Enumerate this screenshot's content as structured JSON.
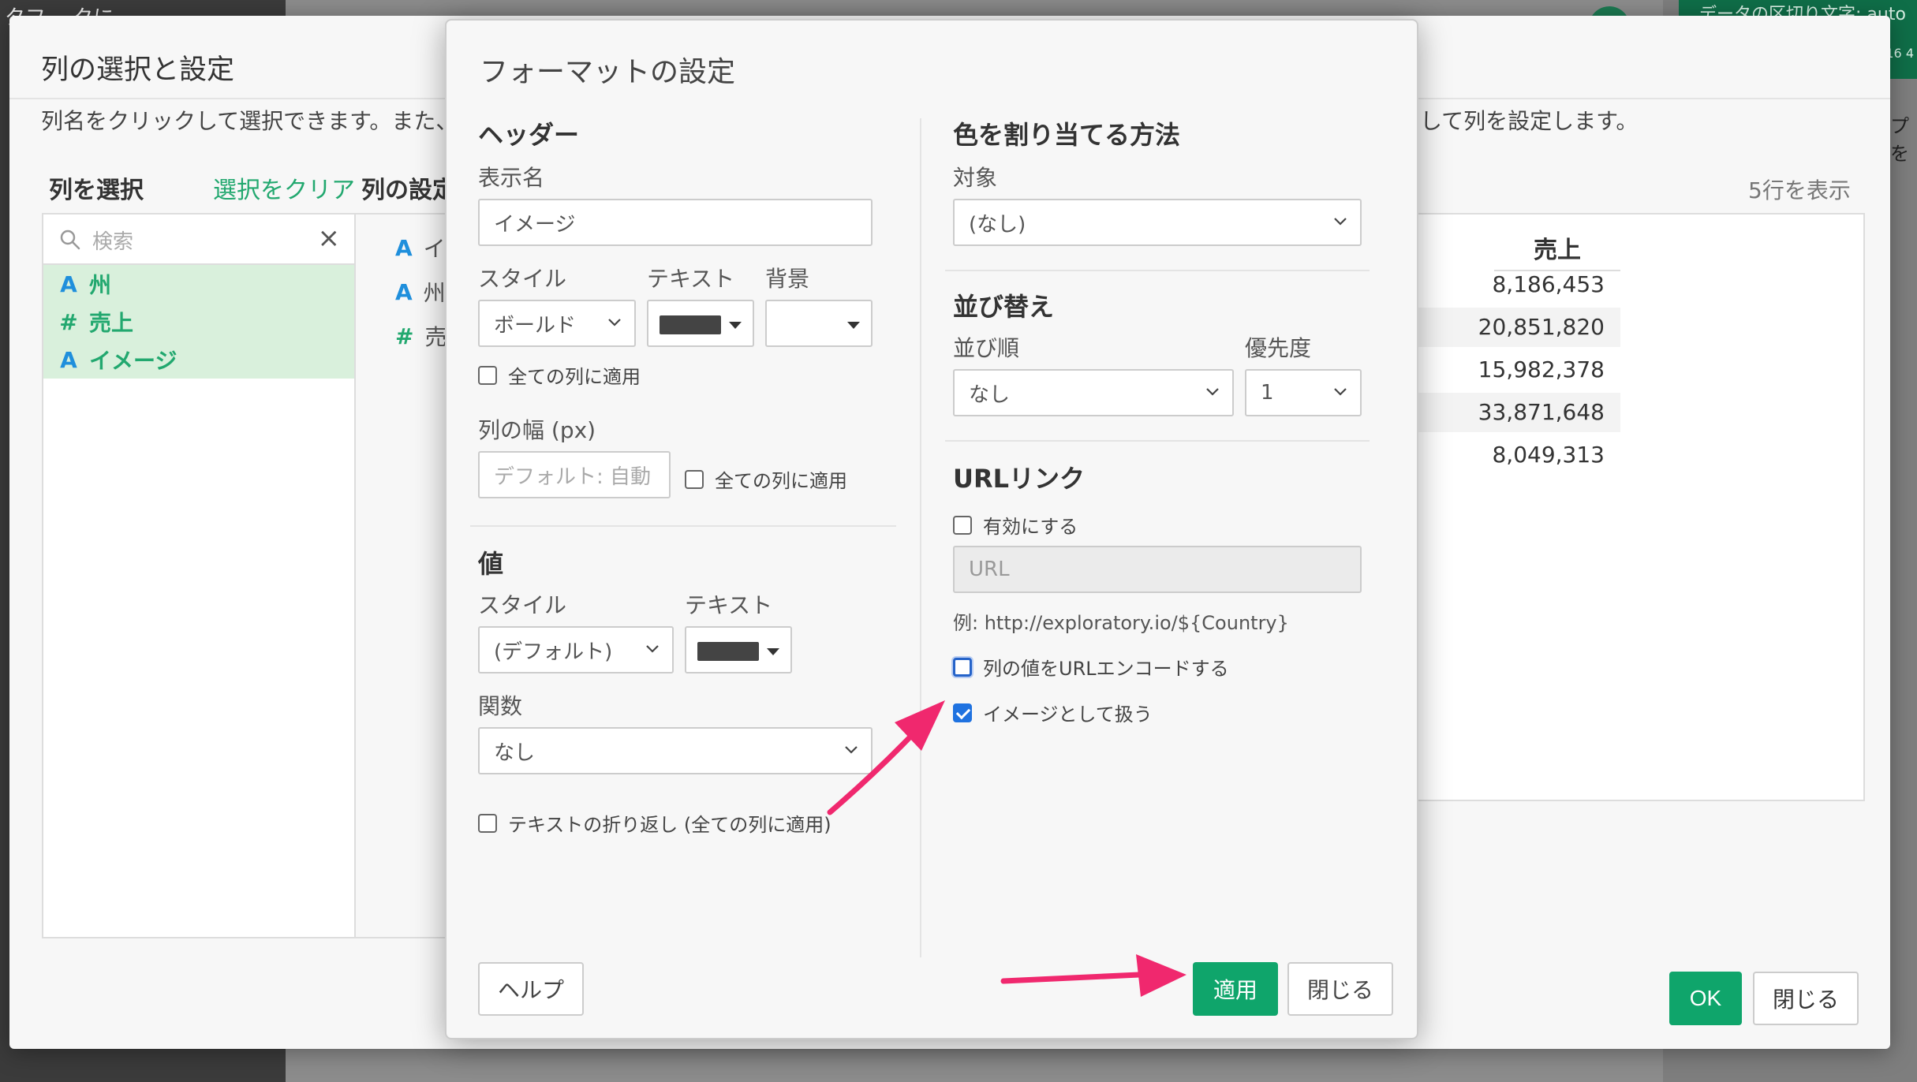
{
  "background": {
    "left_strip_text": "タフ… クに …",
    "green_bar_text": "データの区切り文字: auto",
    "green_bar_sub": "16 4",
    "right_fragment": "プを"
  },
  "outer_dialog": {
    "title": "列の選択と設定",
    "description_left": "列名をクリックして選択できます。また、",
    "description_right": "ーして列を設定します。",
    "select_heading": "列を選択",
    "clear_selection": "選択をクリア",
    "config_heading": "列の設定",
    "search_placeholder": "検索",
    "columns": [
      {
        "type_icon": "A",
        "name": "州"
      },
      {
        "type_icon": "#",
        "name": "売上"
      },
      {
        "type_icon": "A",
        "name": "イメージ"
      }
    ],
    "config_columns": [
      {
        "type_icon": "A",
        "name": "イ"
      },
      {
        "type_icon": "A",
        "name": "州"
      },
      {
        "type_icon": "#",
        "name": "売"
      }
    ],
    "rows_label": "5行を表示",
    "preview_header": "売上",
    "preview_values": [
      "8,186,453",
      "20,851,820",
      "15,982,378",
      "33,871,648",
      "8,049,313"
    ],
    "ok_label": "OK",
    "close_label": "閉じる"
  },
  "format_dialog": {
    "title": "フォーマットの設定",
    "header_section": {
      "heading": "ヘッダー",
      "display_name_label": "表示名",
      "display_name_value": "イメージ",
      "style_label": "スタイル",
      "text_label": "テキスト",
      "background_label": "背景",
      "style_value": "ボールド",
      "apply_all_label": "全ての列に適用",
      "width_label": "列の幅 (px)",
      "width_placeholder": "デフォルト: 自動",
      "width_apply_all_label": "全ての列に適用"
    },
    "value_section": {
      "heading": "値",
      "style_label": "スタイル",
      "text_label": "テキスト",
      "style_value": "(デフォルト)",
      "function_label": "関数",
      "function_value": "なし",
      "wrap_label": "テキストの折り返し (全ての列に適用)"
    },
    "color_section": {
      "heading": "色を割り当てる方法",
      "target_label": "対象",
      "target_value": "(なし)"
    },
    "sort_section": {
      "heading": "並び替え",
      "order_label": "並び順",
      "priority_label": "優先度",
      "order_value": "なし",
      "priority_value": "1"
    },
    "url_section": {
      "heading": "URLリンク",
      "enable_label": "有効にする",
      "url_placeholder": "URL",
      "example": "例: http://exploratory.io/${Country}",
      "encode_label": "列の値をURLエンコードする",
      "image_label": "イメージとして扱う",
      "image_checked": true
    },
    "help_label": "ヘルプ",
    "apply_label": "適用",
    "close_label": "閉じる"
  },
  "colors": {
    "accent": "#0fa56b",
    "arrow": "#f0286e",
    "swatch": "#444444",
    "checkbox": "#1f72e0"
  }
}
